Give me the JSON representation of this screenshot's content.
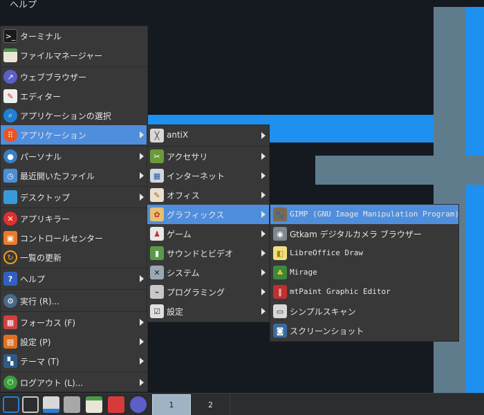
{
  "top": {
    "help": "ヘルプ"
  },
  "main_menu": {
    "items": [
      {
        "label": "ターミナル",
        "icon": "terminal-icon"
      },
      {
        "label": "ファイルマネージャー",
        "icon": "file-manager-icon"
      },
      {
        "label": "ウェブブラウザー",
        "icon": "web-browser-icon"
      },
      {
        "label": "エディター",
        "icon": "editor-icon"
      },
      {
        "label": "アプリケーションの選択",
        "icon": "app-select-icon"
      },
      {
        "label": "アプリケーション",
        "icon": "applications-icon"
      },
      {
        "label": "パーソナル",
        "icon": "personal-icon"
      },
      {
        "label": "最近開いたファイル",
        "icon": "recent-files-icon"
      },
      {
        "label": "デスクトップ",
        "icon": "desktop-icon"
      },
      {
        "label": "アプリキラー",
        "icon": "app-killer-icon"
      },
      {
        "label": "コントロールセンター",
        "icon": "control-center-icon"
      },
      {
        "label": "一覧の更新",
        "icon": "refresh-list-icon"
      },
      {
        "label": "ヘルプ",
        "icon": "help-icon"
      },
      {
        "label": "実行 (R)...",
        "icon": "run-icon"
      },
      {
        "label": "フォーカス (F)",
        "icon": "focus-icon"
      },
      {
        "label": "設定 (P)",
        "icon": "settings-icon"
      },
      {
        "label": "テーマ (T)",
        "icon": "theme-icon"
      },
      {
        "label": "ログアウト (L)...",
        "icon": "logout-icon"
      }
    ]
  },
  "apps_menu": {
    "items": [
      {
        "label": "antiX",
        "icon": "antix-icon"
      },
      {
        "label": "アクセサリ",
        "icon": "accessories-icon"
      },
      {
        "label": "インターネット",
        "icon": "internet-icon"
      },
      {
        "label": "オフィス",
        "icon": "office-icon"
      },
      {
        "label": "グラフィックス",
        "icon": "graphics-icon"
      },
      {
        "label": "ゲーム",
        "icon": "games-icon"
      },
      {
        "label": "サウンドとビデオ",
        "icon": "sound-video-icon"
      },
      {
        "label": "システム",
        "icon": "system-icon"
      },
      {
        "label": "プログラミング",
        "icon": "programming-icon"
      },
      {
        "label": "設定",
        "icon": "preferences-icon"
      }
    ]
  },
  "graphics_menu": {
    "items": [
      {
        "label": "GIMP (GNU Image Manipulation Program)",
        "icon": "gimp-icon"
      },
      {
        "label": "Gtkam デジタルカメラ ブラウザー",
        "icon": "gtkam-icon"
      },
      {
        "label": "LibreOffice Draw",
        "icon": "libreoffice-draw-icon"
      },
      {
        "label": "Mirage",
        "icon": "mirage-icon"
      },
      {
        "label": "mtPaint Graphic Editor",
        "icon": "mtpaint-icon"
      },
      {
        "label": "シンプルスキャン",
        "icon": "simple-scan-icon"
      },
      {
        "label": "スクリーンショット",
        "icon": "screenshot-icon"
      }
    ]
  },
  "taskbar": {
    "workspaces": [
      "1",
      "2"
    ],
    "active_workspace": "1"
  },
  "colors": {
    "menu_bg": "#383838",
    "highlight": "#4f8edc",
    "wallpaper_blue": "#1e90f0",
    "wallpaper_grey": "#5f7c8c"
  }
}
